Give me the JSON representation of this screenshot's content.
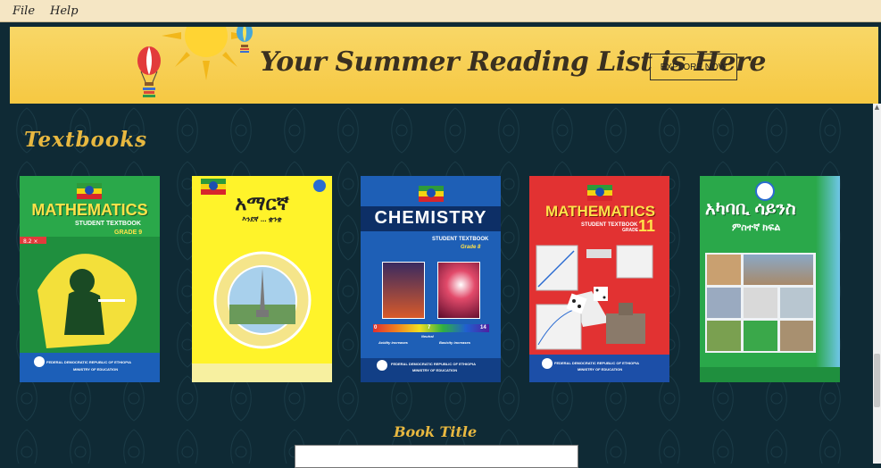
{
  "menubar": {
    "file": "File",
    "help": "Help"
  },
  "banner": {
    "title": "Your Summer Reading List is Here",
    "cta": "EXPLORE NOW"
  },
  "section": {
    "title": "Textbooks"
  },
  "books": [
    {
      "title": "MATHEMATICS",
      "subtitle": "STUDENT TEXTBOOK",
      "grade": "GRADE 9",
      "footer": "FEDERAL DEMOCRATIC REPUBLIC OF ETHIOPIA",
      "footer2": "MINISTRY OF EDUCATION"
    },
    {
      "title": "አማርኛ",
      "subtitle": "እንደኛ ... ቋንቋ",
      "grade": "",
      "footer": "",
      "footer2": ""
    },
    {
      "title": "CHEMISTRY",
      "subtitle": "STUDENT TEXTBOOK",
      "grade": "Grade 8",
      "footer": "FEDERAL DEMOCRATIC REPUBLIC OF ETHIOPIA",
      "footer2": "MINISTRY OF EDUCATION",
      "scale": [
        "0",
        "7",
        "14"
      ],
      "scale_mid": "Neutral",
      "scale_left": "Acidity increases",
      "scale_right": "Basicity increases"
    },
    {
      "title": "MATHEMATICS",
      "subtitle": "STUDENT TEXTBOOK",
      "grade": "11",
      "grade_label": "GRADE",
      "footer": "FEDERAL DEMOCRATIC REPUBLIC OF ETHIOPIA",
      "footer2": "MINISTRY OF EDUCATION"
    },
    {
      "title": "አካባቢ ሳይንስ",
      "subtitle": "ምስተኛ ክፍል",
      "grade": "",
      "footer": "",
      "footer2": ""
    }
  ],
  "form": {
    "label": "Book Title",
    "value": ""
  },
  "colors": {
    "background": "#0f2a35",
    "accent": "#e8b840",
    "banner": "#f6c842"
  }
}
